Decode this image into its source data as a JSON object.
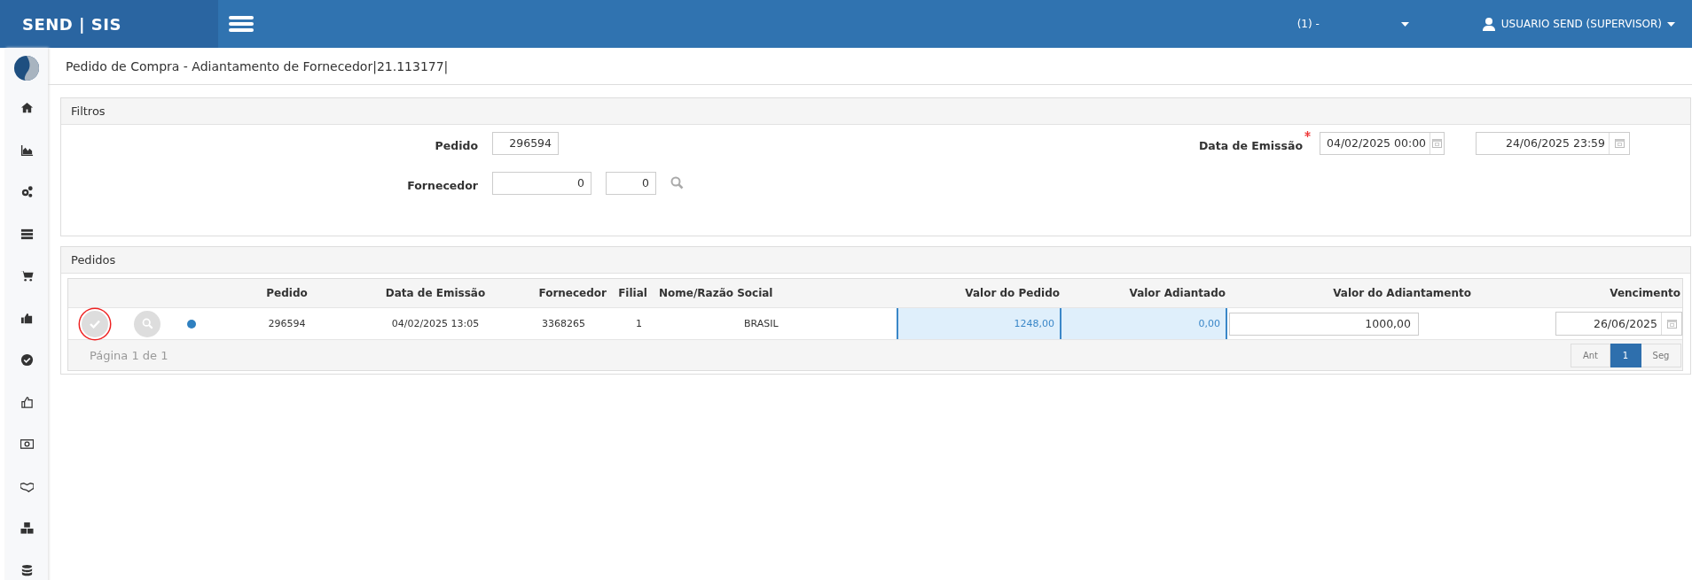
{
  "header": {
    "brand": "SEND | SIS",
    "company": "(1) -",
    "user": "USUARIO SEND (SUPERVISOR)"
  },
  "page_title": "Pedido de Compra - Adiantamento de Fornecedor|21.113177|",
  "filters": {
    "title": "Filtros",
    "fields": [
      {
        "kind": "text",
        "label": "Pedido",
        "required": false,
        "values": [
          "296594"
        ]
      },
      {
        "kind": "lookup",
        "label": "Fornecedor",
        "required": false,
        "values": [
          "0",
          "0"
        ]
      },
      {
        "kind": "date",
        "label": "Data de Emissão",
        "required": true,
        "values": [
          "04/02/2025 00:00",
          "24/06/2025 23:59"
        ]
      }
    ]
  },
  "orders": {
    "title": "Pedidos",
    "columns": [
      "Pedido",
      "Data de Emissão",
      "Fornecedor",
      "Filial",
      "Nome/Razão Social",
      "Valor do Pedido",
      "Valor Adiantado",
      "Valor do Adiantamento",
      "Vencimento"
    ],
    "rows": [
      {
        "highlighted": true,
        "color": "#2f80c0",
        "pedido": "296594",
        "data": "04/02/2025 13:05",
        "fornecedor": "3368265",
        "filial": "1",
        "nome": "BRASIL",
        "valor_pedido": "1248,00",
        "valor_adiantado": "0,00",
        "valor_adiantamento": "1000,00",
        "vencimento": "26/06/2025"
      }
    ],
    "footer": "Página 1 de 1",
    "pages": [
      {
        "label": "Ant",
        "selected": false
      },
      {
        "label": "1",
        "selected": true
      },
      {
        "label": "Seg",
        "selected": false
      }
    ]
  }
}
